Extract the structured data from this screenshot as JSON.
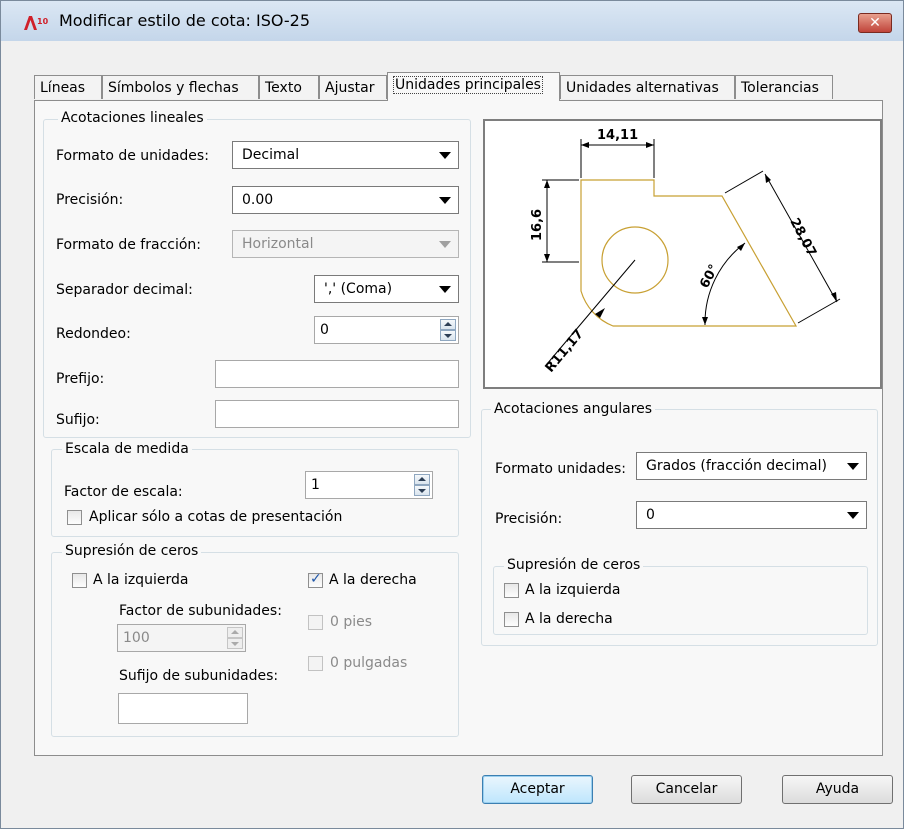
{
  "window": {
    "title": "Modificar estilo de cota: ISO-25",
    "close_label": "✕"
  },
  "tabs": [
    {
      "label": "Líneas"
    },
    {
      "label": "Símbolos y flechas"
    },
    {
      "label": "Texto"
    },
    {
      "label": "Ajustar"
    },
    {
      "label": "Unidades principales"
    },
    {
      "label": "Unidades alternativas"
    },
    {
      "label": "Tolerancias"
    }
  ],
  "linear": {
    "group_title": "Acotaciones lineales",
    "unit_format_label": "Formato de unidades:",
    "unit_format_value": "Decimal",
    "precision_label": "Precisión:",
    "precision_value": "0.00",
    "fraction_format_label": "Formato de fracción:",
    "fraction_format_value": "Horizontal",
    "decimal_separator_label": "Separador decimal:",
    "decimal_separator_value": "',' (Coma)",
    "round_label": "Redondeo:",
    "round_value": "0",
    "prefix_label": "Prefijo:",
    "prefix_value": "",
    "suffix_label": "Sufijo:",
    "suffix_value": ""
  },
  "scale": {
    "group_title": "Escala de medida",
    "factor_label": "Factor de escala:",
    "factor_value": "1",
    "layout_only_label": "Aplicar sólo a cotas de presentación",
    "layout_only_checked": false
  },
  "zero_linear": {
    "group_title": "Supresión de ceros",
    "leading_label": "A la izquierda",
    "leading_checked": false,
    "trailing_label": "A la derecha",
    "trailing_checked": true,
    "subunit_factor_label": "Factor de subunidades:",
    "subunit_factor_value": "100",
    "subunit_suffix_label": "Sufijo de subunidades:",
    "subunit_suffix_value": "",
    "feet_label": "0 pies",
    "inches_label": "0 pulgadas"
  },
  "preview": {
    "dim_top": "14,11",
    "dim_left": "16,6",
    "dim_diag": "28,07",
    "dim_angle": "60°",
    "dim_radius": "R11,17",
    "line_color": "#c8a033"
  },
  "angular": {
    "group_title": "Acotaciones angulares",
    "units_format_label": "Formato unidades:",
    "units_format_value": "Grados (fracción decimal)",
    "precision_label": "Precisión:",
    "precision_value": "0"
  },
  "zero_angular": {
    "group_title": "Supresión de ceros",
    "leading_label": "A la izquierda",
    "leading_checked": false,
    "trailing_label": "A la derecha",
    "trailing_checked": false
  },
  "buttons": {
    "ok": "Aceptar",
    "cancel": "Cancelar",
    "help": "Ayuda"
  }
}
